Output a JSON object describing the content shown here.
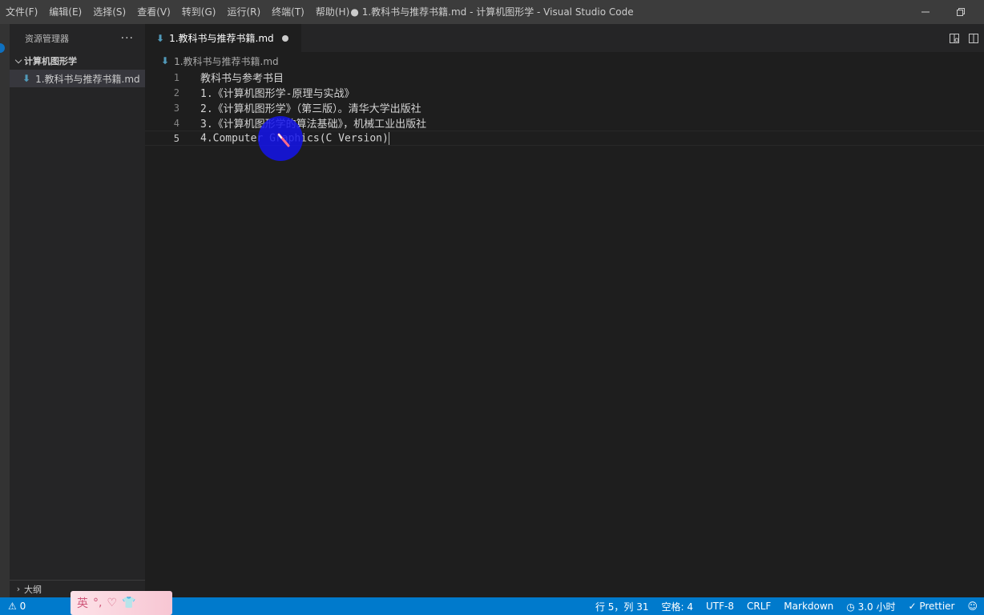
{
  "titlebar": {
    "menu": [
      "文件(F)",
      "编辑(E)",
      "选择(S)",
      "查看(V)",
      "转到(G)",
      "运行(R)",
      "终端(T)",
      "帮助(H)"
    ],
    "title": "● 1.教科书与推荐书籍.md - 计算机图形学 - Visual Studio Code"
  },
  "sidebar": {
    "header": "资源管理器",
    "more": "···",
    "folder": "计算机图形学",
    "file": "1.教科书与推荐书籍.md",
    "outline": "大纲"
  },
  "editor": {
    "tab_label": "1.教科书与推荐书籍.md",
    "breadcrumb": "1.教科书与推荐书籍.md",
    "lines": [
      {
        "n": "1",
        "text": "教科书与参考书目"
      },
      {
        "n": "2",
        "text": "1.《计算机图形学-原理与实战》"
      },
      {
        "n": "3",
        "text": "2.《计算机图形学》（第三版）。清华大学出版社"
      },
      {
        "n": "4",
        "text": "3.《计算机图形学的算法基础》，机械工业出版社"
      },
      {
        "n": "5",
        "text": "4.Computer Graphics(C Version)"
      }
    ]
  },
  "statusbar": {
    "problems": "⚠ 0",
    "position": "行 5，列 31",
    "spaces": "空格: 4",
    "encoding": "UTF-8",
    "eol": "CRLF",
    "language": "Markdown",
    "time": "3.0 小时",
    "formatter": "Prettier"
  },
  "ime": {
    "label": "英"
  },
  "colors": {
    "titlebar": "#3c3c3c",
    "sidebar": "#252526",
    "editor": "#1e1e1e",
    "statusbar": "#007acc",
    "markdown_icon": "#519aba"
  }
}
